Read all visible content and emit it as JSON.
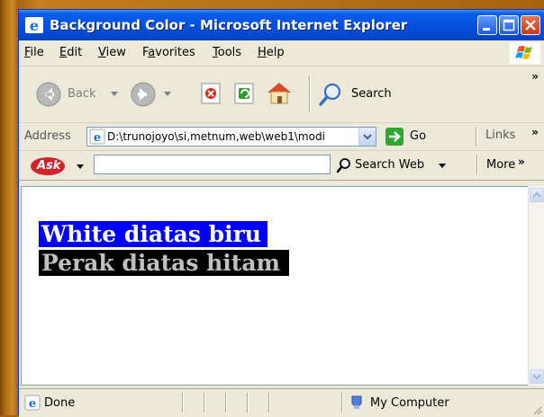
{
  "window": {
    "title": "Background Color - Microsoft Internet Explorer"
  },
  "menu": {
    "items": [
      {
        "label": "File",
        "underline": "F",
        "rest": "ile"
      },
      {
        "label": "Edit",
        "underline": "E",
        "rest": "dit"
      },
      {
        "label": "View",
        "underline": "V",
        "rest": "iew"
      },
      {
        "label": "Favorites",
        "underline": "a",
        "prefix": "F",
        "rest": "vorites"
      },
      {
        "label": "Tools",
        "underline": "T",
        "rest": "ools"
      },
      {
        "label": "Help",
        "underline": "H",
        "rest": "elp"
      }
    ]
  },
  "toolbar": {
    "back_label": "Back",
    "search_label": "Search",
    "chevron": "»"
  },
  "address": {
    "label": "Address",
    "value": "D:\\trunojoyo\\si,metnum,web\\web1\\modi",
    "go_label": "Go",
    "links_label": "Links",
    "chevron": "»"
  },
  "askbar": {
    "logo_text": "Ask",
    "search_value": "",
    "search_web_label": "Search Web",
    "more_label": "More",
    "chevron": "»"
  },
  "content": {
    "line1": "White diatas biru",
    "line2": "Perak diatas hitam",
    "line1_colors": {
      "fg": "#ffffff",
      "bg": "#0000ff"
    },
    "line2_colors": {
      "fg": "#c0c0c0",
      "bg": "#000000"
    }
  },
  "status": {
    "text": "Done",
    "zone": "My Computer"
  }
}
